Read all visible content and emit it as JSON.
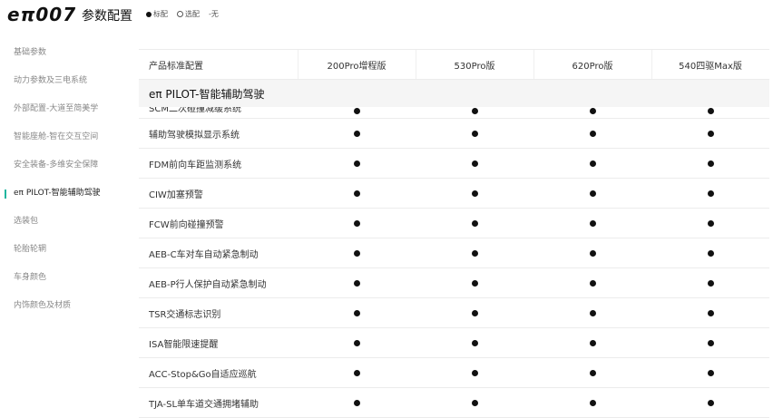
{
  "header": {
    "logo": "eπ007",
    "title": "参数配置",
    "legend": {
      "standard": "标配",
      "optional": "选配",
      "none": "-无"
    }
  },
  "sidebar": {
    "items": [
      {
        "label": "基础参数",
        "active": false
      },
      {
        "label": "动力参数及三电系统",
        "active": false
      },
      {
        "label": "外部配置-大道至简美学",
        "active": false
      },
      {
        "label": "智能座舱-智在交互空间",
        "active": false
      },
      {
        "label": "安全装备-多维安全保障",
        "active": false
      },
      {
        "label": "eπ PILOT-智能辅助驾驶",
        "active": true
      },
      {
        "label": "选装包",
        "active": false
      },
      {
        "label": "轮胎轮辋",
        "active": false
      },
      {
        "label": "车身颜色",
        "active": false
      },
      {
        "label": "内饰颜色及材质",
        "active": false
      }
    ]
  },
  "table": {
    "header_label": "产品标准配置",
    "columns": [
      "200Pro增程版",
      "530Pro版",
      "620Pro版",
      "540四驱Max版"
    ],
    "section_title": "eπ PILOT-智能辅助驾驶",
    "cut_row": {
      "label": "SCM二次碰撞减缓系统",
      "values": [
        "●",
        "●",
        "●",
        "●"
      ]
    },
    "rows": [
      {
        "label": "辅助驾驶模拟显示系统",
        "values": [
          "●",
          "●",
          "●",
          "●"
        ]
      },
      {
        "label": "FDM前向车距监测系统",
        "values": [
          "●",
          "●",
          "●",
          "●"
        ]
      },
      {
        "label": "CIW加塞预警",
        "values": [
          "●",
          "●",
          "●",
          "●"
        ]
      },
      {
        "label": "FCW前向碰撞预警",
        "values": [
          "●",
          "●",
          "●",
          "●"
        ]
      },
      {
        "label": "AEB-C车对车自动紧急制动",
        "values": [
          "●",
          "●",
          "●",
          "●"
        ]
      },
      {
        "label": "AEB-P行人保护自动紧急制动",
        "values": [
          "●",
          "●",
          "●",
          "●"
        ]
      },
      {
        "label": "TSR交通标志识别",
        "values": [
          "●",
          "●",
          "●",
          "●"
        ]
      },
      {
        "label": "ISA智能限速提醒",
        "values": [
          "●",
          "●",
          "●",
          "●"
        ]
      },
      {
        "label": "ACC-Stop&Go自适应巡航",
        "values": [
          "●",
          "●",
          "●",
          "●"
        ]
      },
      {
        "label": "TJA-SL单车道交通拥堵辅助",
        "values": [
          "●",
          "●",
          "●",
          "●"
        ]
      }
    ]
  },
  "colors": {
    "accent": "#1fb69f",
    "section_bg": "#f5f5f5",
    "divider": "#ececec"
  },
  "icons": {
    "standard": "filled-circle-icon",
    "optional": "hollow-circle-icon"
  }
}
